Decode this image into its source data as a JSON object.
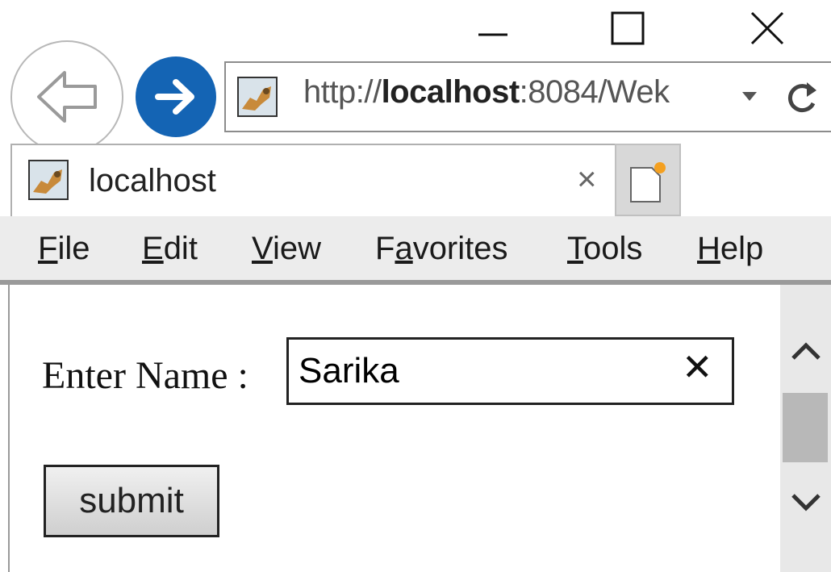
{
  "window": {
    "minimize_icon": "minimize-icon",
    "maximize_icon": "maximize-icon",
    "close_icon": "close-icon"
  },
  "nav": {
    "back_icon": "back-arrow-icon",
    "forward_icon": "forward-arrow-icon",
    "url_prefix": "http://",
    "url_host": "localhost",
    "url_rest": ":8084/Wek",
    "dropdown_icon": "dropdown-triangle-icon",
    "refresh_icon": "refresh-icon"
  },
  "tab": {
    "title": "localhost",
    "close": "×",
    "favicon": "tomcat-favicon-icon",
    "new_tab_icon": "new-tab-icon"
  },
  "menu": {
    "items": [
      {
        "key": "F",
        "rest": "ile"
      },
      {
        "key": "E",
        "rest": "dit"
      },
      {
        "key": "V",
        "rest": "iew"
      },
      {
        "pre": "F",
        "key": "a",
        "rest": "vorites"
      },
      {
        "key": "T",
        "rest": "ools"
      },
      {
        "key": "H",
        "rest": "elp"
      }
    ]
  },
  "form": {
    "label": "Enter Name :",
    "name_value": "Sarika",
    "clear": "✕",
    "submit_label": "submit"
  },
  "colors": {
    "forward_button": "#1464b4",
    "menubar_bg": "#ececec"
  }
}
